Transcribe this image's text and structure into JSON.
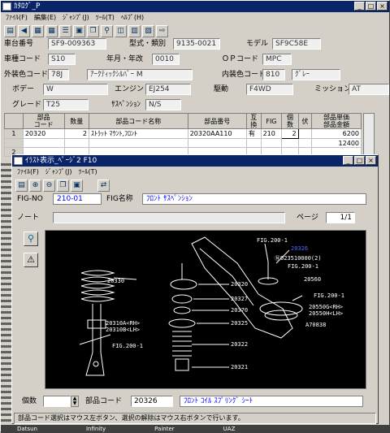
{
  "main": {
    "title": "ｶﾀﾛｸﾞ_P",
    "title_buttons": [
      "_",
      "□",
      "×"
    ],
    "menu": [
      "ﾌｧｲﾙ(F)",
      "編集(E)",
      "ｼﾞｬﾝﾌﾟ(J)",
      "ﾂｰﾙ(T)",
      "ﾍﾙﾌﾟ(H)"
    ],
    "labels": {
      "chassis_no": "車台番号",
      "type_class": "型式・類別",
      "model": "モデル",
      "vehicle_code": "車種コード",
      "year_month": "年月・年改",
      "op_code": "ＯＰコード",
      "ext_color": "外装色コード",
      "int_color": "内装色コード",
      "body": "ボデー",
      "engine": "エンジン",
      "drive": "駆動",
      "mission": "ミッション",
      "grade": "グレード",
      "suspension": "ｻｽﾍﾟﾝｼｮﾝ"
    },
    "values": {
      "chassis_no": "SF9-009363",
      "type_class": "9135-0021",
      "model": "SF9C58E",
      "vehicle_code": "S10",
      "year_month": "0010",
      "op_code": "MPC",
      "ext_color_code": "78J",
      "ext_color_name": "ｱｰｸﾃｨｯｸｼﾙﾊﾞｰ M",
      "int_color_code": "810",
      "int_color_name": "ｸﾞﾚｰ",
      "body": "W",
      "engine": "EJ254",
      "drive": "F4WD",
      "mission": "AT",
      "grade": "T25",
      "suspension": "N/S"
    },
    "table": {
      "headers": [
        "部品\nコード",
        "数量",
        "部品コード名称",
        "部品番号",
        "互換",
        "FIG",
        "個数",
        "伏",
        "部品単価\n部品金額"
      ],
      "rows": [
        [
          "1",
          "20320",
          "2",
          "ｽﾄﾗｯﾄ ﾏｳﾝﾄ,ﾌﾛﾝﾄ",
          "20320AA110",
          "有",
          "210",
          "2",
          "",
          "6200"
        ],
        [
          "",
          "",
          "",
          "",
          "",
          "",
          "",
          "",
          "",
          "12400"
        ],
        [
          "2",
          "",
          "",
          "",
          "",
          "",
          "",
          "",
          "",
          ""
        ],
        [
          "",
          "",
          "",
          "",
          "",
          "",
          "",
          "",
          "",
          ""
        ]
      ]
    }
  },
  "fig": {
    "title": "ｲﾗｽﾄ表示_ﾍﾟｰｼﾞ2 F10",
    "title_buttons": [
      "_",
      "□",
      "×"
    ],
    "menu": [
      "ﾌｧｲﾙ(F)",
      "ｼﾞｬﾝﾌﾟ(J)",
      "ﾂｰﾙ(T)"
    ],
    "fig_no_label": "FIG-NO",
    "fig_no": "210-01",
    "fig_name_label": "FIG名称",
    "fig_name": "ﾌﾛﾝﾄ ｻｽﾍﾟﾝｼｮﾝ",
    "note_label": "ノート",
    "page_label": "ページ",
    "page_value": "1/1",
    "qty_label": "個数",
    "part_code_label": "部品コード",
    "part_code": "20326",
    "part_name": "ﾌﾛﾝﾄ ｺｲﾙ ｽﾌﾟﾘﾝｸﾞ ｼｰﾄ",
    "status": "部品コード選択はマウス左ボタン、選択の解除はマウス右ボタンで行います。",
    "diagram_labels": [
      "FIG.200-1",
      "20326",
      "Ⓝ023510000(2)",
      "FIG.200-1",
      "20330",
      "20560",
      "FIG.200-1",
      "20320",
      "20327",
      "20370",
      "20550G<RH>",
      "20550H<LH>",
      "A70838",
      "20310A<RH>",
      "20310B<LH>",
      "20325",
      "FIG.200-1",
      "20322",
      "20321"
    ]
  },
  "taskbar": [
    "Datsun",
    "Infinity",
    "Painter",
    "UAZ"
  ]
}
